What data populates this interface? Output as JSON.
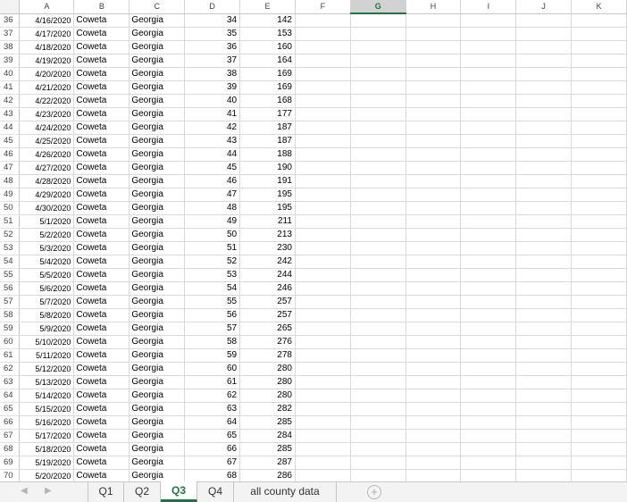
{
  "columns": [
    "A",
    "B",
    "C",
    "D",
    "E",
    "F",
    "G",
    "H",
    "I",
    "J",
    "K"
  ],
  "selected_column": "G",
  "rows": [
    {
      "row": "36",
      "date": "4/16/2020",
      "county": "Coweta",
      "state": "Georgia",
      "day": "34",
      "cases": "142"
    },
    {
      "row": "37",
      "date": "4/17/2020",
      "county": "Coweta",
      "state": "Georgia",
      "day": "35",
      "cases": "153"
    },
    {
      "row": "38",
      "date": "4/18/2020",
      "county": "Coweta",
      "state": "Georgia",
      "day": "36",
      "cases": "160"
    },
    {
      "row": "39",
      "date": "4/19/2020",
      "county": "Coweta",
      "state": "Georgia",
      "day": "37",
      "cases": "164"
    },
    {
      "row": "40",
      "date": "4/20/2020",
      "county": "Coweta",
      "state": "Georgia",
      "day": "38",
      "cases": "169"
    },
    {
      "row": "41",
      "date": "4/21/2020",
      "county": "Coweta",
      "state": "Georgia",
      "day": "39",
      "cases": "169"
    },
    {
      "row": "42",
      "date": "4/22/2020",
      "county": "Coweta",
      "state": "Georgia",
      "day": "40",
      "cases": "168"
    },
    {
      "row": "43",
      "date": "4/23/2020",
      "county": "Coweta",
      "state": "Georgia",
      "day": "41",
      "cases": "177"
    },
    {
      "row": "44",
      "date": "4/24/2020",
      "county": "Coweta",
      "state": "Georgia",
      "day": "42",
      "cases": "187"
    },
    {
      "row": "45",
      "date": "4/25/2020",
      "county": "Coweta",
      "state": "Georgia",
      "day": "43",
      "cases": "187"
    },
    {
      "row": "46",
      "date": "4/26/2020",
      "county": "Coweta",
      "state": "Georgia",
      "day": "44",
      "cases": "188"
    },
    {
      "row": "47",
      "date": "4/27/2020",
      "county": "Coweta",
      "state": "Georgia",
      "day": "45",
      "cases": "190"
    },
    {
      "row": "48",
      "date": "4/28/2020",
      "county": "Coweta",
      "state": "Georgia",
      "day": "46",
      "cases": "191"
    },
    {
      "row": "49",
      "date": "4/29/2020",
      "county": "Coweta",
      "state": "Georgia",
      "day": "47",
      "cases": "195"
    },
    {
      "row": "50",
      "date": "4/30/2020",
      "county": "Coweta",
      "state": "Georgia",
      "day": "48",
      "cases": "195"
    },
    {
      "row": "51",
      "date": "5/1/2020",
      "county": "Coweta",
      "state": "Georgia",
      "day": "49",
      "cases": "211"
    },
    {
      "row": "52",
      "date": "5/2/2020",
      "county": "Coweta",
      "state": "Georgia",
      "day": "50",
      "cases": "213"
    },
    {
      "row": "53",
      "date": "5/3/2020",
      "county": "Coweta",
      "state": "Georgia",
      "day": "51",
      "cases": "230"
    },
    {
      "row": "54",
      "date": "5/4/2020",
      "county": "Coweta",
      "state": "Georgia",
      "day": "52",
      "cases": "242"
    },
    {
      "row": "55",
      "date": "5/5/2020",
      "county": "Coweta",
      "state": "Georgia",
      "day": "53",
      "cases": "244"
    },
    {
      "row": "56",
      "date": "5/6/2020",
      "county": "Coweta",
      "state": "Georgia",
      "day": "54",
      "cases": "246"
    },
    {
      "row": "57",
      "date": "5/7/2020",
      "county": "Coweta",
      "state": "Georgia",
      "day": "55",
      "cases": "257"
    },
    {
      "row": "58",
      "date": "5/8/2020",
      "county": "Coweta",
      "state": "Georgia",
      "day": "56",
      "cases": "257"
    },
    {
      "row": "59",
      "date": "5/9/2020",
      "county": "Coweta",
      "state": "Georgia",
      "day": "57",
      "cases": "265"
    },
    {
      "row": "60",
      "date": "5/10/2020",
      "county": "Coweta",
      "state": "Georgia",
      "day": "58",
      "cases": "276"
    },
    {
      "row": "61",
      "date": "5/11/2020",
      "county": "Coweta",
      "state": "Georgia",
      "day": "59",
      "cases": "278"
    },
    {
      "row": "62",
      "date": "5/12/2020",
      "county": "Coweta",
      "state": "Georgia",
      "day": "60",
      "cases": "280"
    },
    {
      "row": "63",
      "date": "5/13/2020",
      "county": "Coweta",
      "state": "Georgia",
      "day": "61",
      "cases": "280"
    },
    {
      "row": "64",
      "date": "5/14/2020",
      "county": "Coweta",
      "state": "Georgia",
      "day": "62",
      "cases": "280"
    },
    {
      "row": "65",
      "date": "5/15/2020",
      "county": "Coweta",
      "state": "Georgia",
      "day": "63",
      "cases": "282"
    },
    {
      "row": "66",
      "date": "5/16/2020",
      "county": "Coweta",
      "state": "Georgia",
      "day": "64",
      "cases": "285"
    },
    {
      "row": "67",
      "date": "5/17/2020",
      "county": "Coweta",
      "state": "Georgia",
      "day": "65",
      "cases": "284"
    },
    {
      "row": "68",
      "date": "5/18/2020",
      "county": "Coweta",
      "state": "Georgia",
      "day": "66",
      "cases": "285"
    },
    {
      "row": "69",
      "date": "5/19/2020",
      "county": "Coweta",
      "state": "Georgia",
      "day": "67",
      "cases": "287"
    },
    {
      "row": "70",
      "date": "5/20/2020",
      "county": "Coweta",
      "state": "Georgia",
      "day": "68",
      "cases": "286"
    }
  ],
  "sheet_nav": {
    "prev_icon": "triangle-left-icon",
    "next_icon": "triangle-right-icon",
    "prev": "◀",
    "next": "▶"
  },
  "sheet_tabs": [
    {
      "label": "Q1",
      "active": false
    },
    {
      "label": "Q2",
      "active": false
    },
    {
      "label": "Q3",
      "active": true
    },
    {
      "label": "Q4",
      "active": false
    },
    {
      "label": "all county data",
      "active": false
    }
  ],
  "new_sheet": {
    "icon": "plus-circle-icon",
    "symbol": "+"
  },
  "colors": {
    "accent": "#217346",
    "gridline": "#d9d9d9",
    "header_bg": "#f3f3f3"
  }
}
